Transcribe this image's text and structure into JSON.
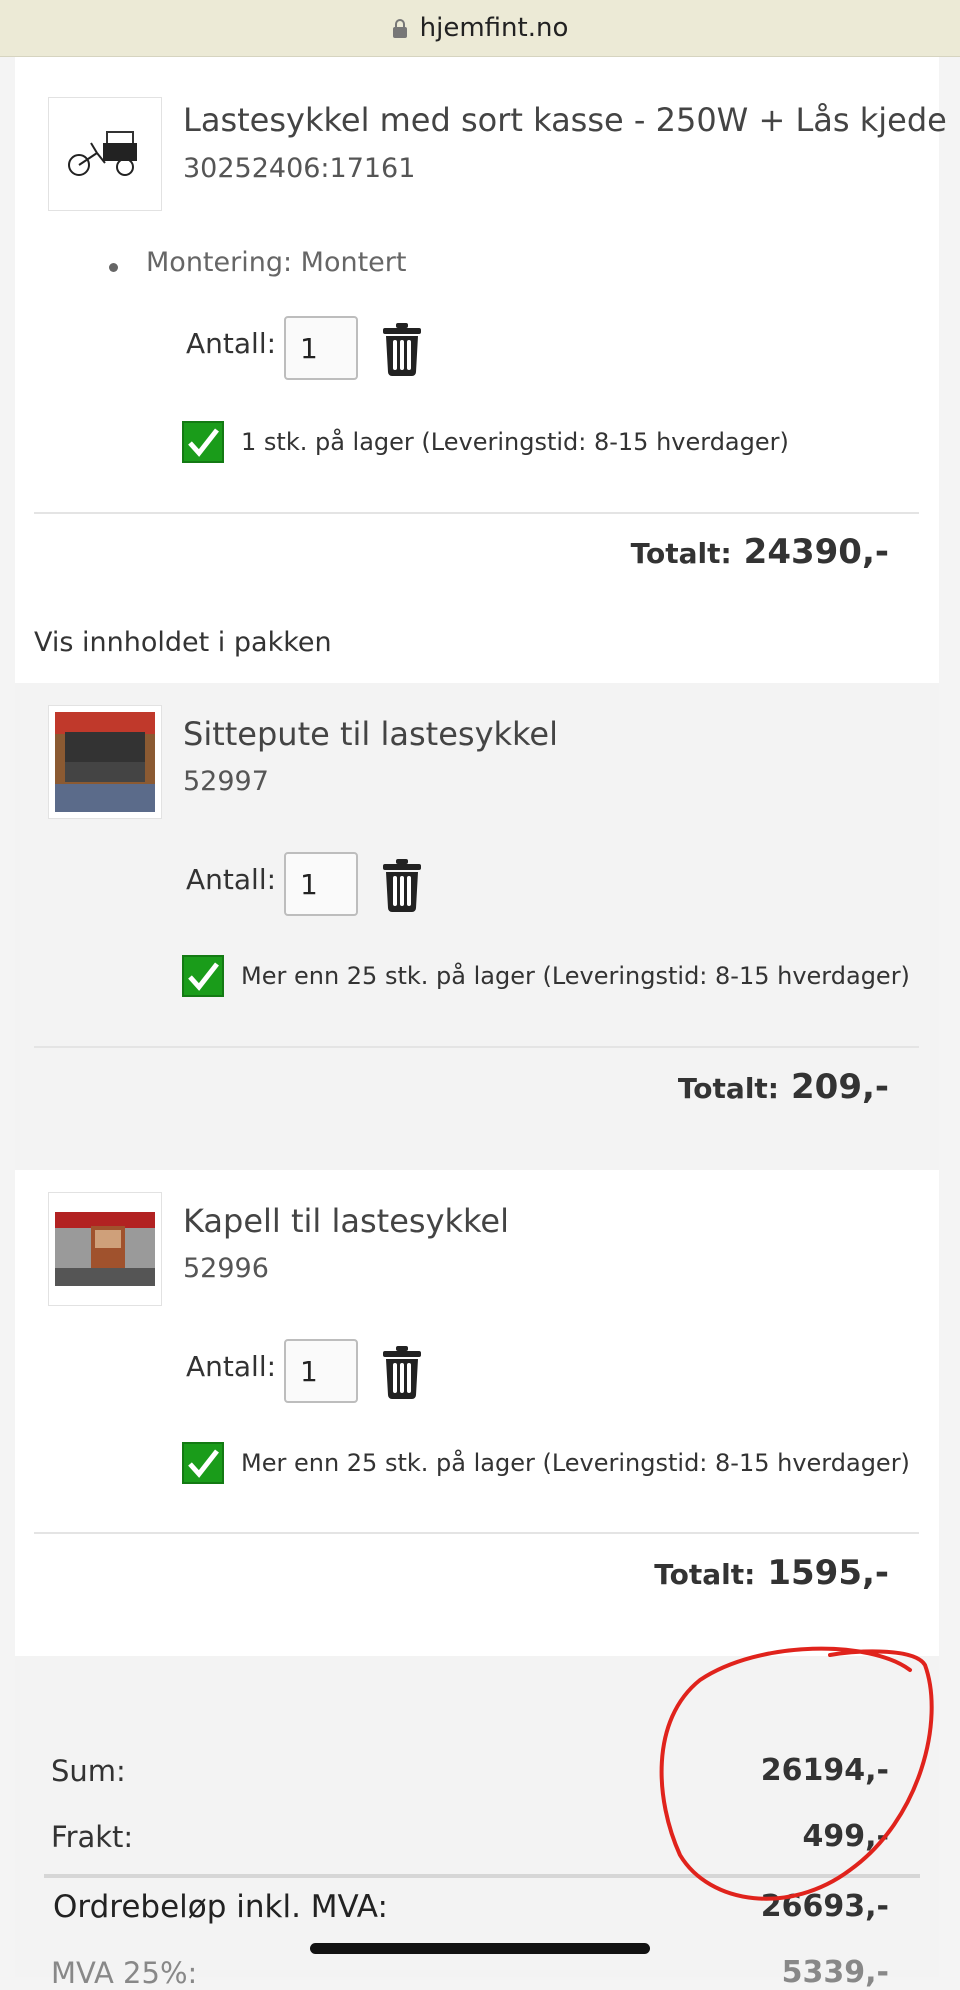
{
  "browser": {
    "url": "hjemfint.no"
  },
  "items": [
    {
      "name": "Lastesykkel med sort kasse - 250W + Lås kjede",
      "sku": "30252406:17161",
      "option": "Montering: Montert",
      "qty_label": "Antall:",
      "qty": "1",
      "stock": "1 stk. på lager (Leveringstid: 8-15 hverdager)",
      "total_label": "Totalt:",
      "total": "24390,-"
    },
    {
      "name": "Sittepute til lastesykkel",
      "sku": "52997",
      "qty_label": "Antall:",
      "qty": "1",
      "stock": "Mer enn 25 stk. på lager (Leveringstid: 8-15 hverdager)",
      "total_label": "Totalt:",
      "total": "209,-"
    },
    {
      "name": "Kapell til lastesykkel",
      "sku": "52996",
      "qty_label": "Antall:",
      "qty": "1",
      "stock": "Mer enn 25 stk. på lager (Leveringstid: 8-15 hverdager)",
      "total_label": "Totalt:",
      "total": "1595,-"
    }
  ],
  "package_link": "Vis innholdet i pakken",
  "summary": {
    "sum_label": "Sum:",
    "sum_value": "26194,-",
    "shipping_label": "Frakt:",
    "shipping_value": "499,-",
    "order_label": "Ordrebeløp inkl. MVA:",
    "order_value": "26693,-",
    "vat_label": "MVA 25%:",
    "vat_value": "5339,-"
  },
  "colors": {
    "annotation": "#e0231c",
    "check_green": "#1a9c1a"
  },
  "icons": [
    "lock-icon",
    "trash-icon",
    "check-icon"
  ]
}
